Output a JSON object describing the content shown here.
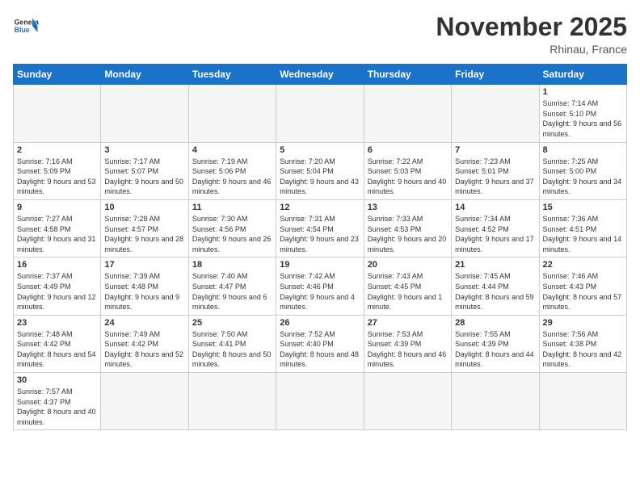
{
  "header": {
    "logo_general": "General",
    "logo_blue": "Blue",
    "month": "November 2025",
    "location": "Rhinau, France"
  },
  "days_of_week": [
    "Sunday",
    "Monday",
    "Tuesday",
    "Wednesday",
    "Thursday",
    "Friday",
    "Saturday"
  ],
  "weeks": [
    [
      {
        "day": "",
        "info": ""
      },
      {
        "day": "",
        "info": ""
      },
      {
        "day": "",
        "info": ""
      },
      {
        "day": "",
        "info": ""
      },
      {
        "day": "",
        "info": ""
      },
      {
        "day": "",
        "info": ""
      },
      {
        "day": "1",
        "info": "Sunrise: 7:14 AM\nSunset: 5:10 PM\nDaylight: 9 hours and 56 minutes."
      }
    ],
    [
      {
        "day": "2",
        "info": "Sunrise: 7:16 AM\nSunset: 5:09 PM\nDaylight: 9 hours and 53 minutes."
      },
      {
        "day": "3",
        "info": "Sunrise: 7:17 AM\nSunset: 5:07 PM\nDaylight: 9 hours and 50 minutes."
      },
      {
        "day": "4",
        "info": "Sunrise: 7:19 AM\nSunset: 5:06 PM\nDaylight: 9 hours and 46 minutes."
      },
      {
        "day": "5",
        "info": "Sunrise: 7:20 AM\nSunset: 5:04 PM\nDaylight: 9 hours and 43 minutes."
      },
      {
        "day": "6",
        "info": "Sunrise: 7:22 AM\nSunset: 5:03 PM\nDaylight: 9 hours and 40 minutes."
      },
      {
        "day": "7",
        "info": "Sunrise: 7:23 AM\nSunset: 5:01 PM\nDaylight: 9 hours and 37 minutes."
      },
      {
        "day": "8",
        "info": "Sunrise: 7:25 AM\nSunset: 5:00 PM\nDaylight: 9 hours and 34 minutes."
      }
    ],
    [
      {
        "day": "9",
        "info": "Sunrise: 7:27 AM\nSunset: 4:58 PM\nDaylight: 9 hours and 31 minutes."
      },
      {
        "day": "10",
        "info": "Sunrise: 7:28 AM\nSunset: 4:57 PM\nDaylight: 9 hours and 28 minutes."
      },
      {
        "day": "11",
        "info": "Sunrise: 7:30 AM\nSunset: 4:56 PM\nDaylight: 9 hours and 26 minutes."
      },
      {
        "day": "12",
        "info": "Sunrise: 7:31 AM\nSunset: 4:54 PM\nDaylight: 9 hours and 23 minutes."
      },
      {
        "day": "13",
        "info": "Sunrise: 7:33 AM\nSunset: 4:53 PM\nDaylight: 9 hours and 20 minutes."
      },
      {
        "day": "14",
        "info": "Sunrise: 7:34 AM\nSunset: 4:52 PM\nDaylight: 9 hours and 17 minutes."
      },
      {
        "day": "15",
        "info": "Sunrise: 7:36 AM\nSunset: 4:51 PM\nDaylight: 9 hours and 14 minutes."
      }
    ],
    [
      {
        "day": "16",
        "info": "Sunrise: 7:37 AM\nSunset: 4:49 PM\nDaylight: 9 hours and 12 minutes."
      },
      {
        "day": "17",
        "info": "Sunrise: 7:39 AM\nSunset: 4:48 PM\nDaylight: 9 hours and 9 minutes."
      },
      {
        "day": "18",
        "info": "Sunrise: 7:40 AM\nSunset: 4:47 PM\nDaylight: 9 hours and 6 minutes."
      },
      {
        "day": "19",
        "info": "Sunrise: 7:42 AM\nSunset: 4:46 PM\nDaylight: 9 hours and 4 minutes."
      },
      {
        "day": "20",
        "info": "Sunrise: 7:43 AM\nSunset: 4:45 PM\nDaylight: 9 hours and 1 minute."
      },
      {
        "day": "21",
        "info": "Sunrise: 7:45 AM\nSunset: 4:44 PM\nDaylight: 8 hours and 59 minutes."
      },
      {
        "day": "22",
        "info": "Sunrise: 7:46 AM\nSunset: 4:43 PM\nDaylight: 8 hours and 57 minutes."
      }
    ],
    [
      {
        "day": "23",
        "info": "Sunrise: 7:48 AM\nSunset: 4:42 PM\nDaylight: 8 hours and 54 minutes."
      },
      {
        "day": "24",
        "info": "Sunrise: 7:49 AM\nSunset: 4:42 PM\nDaylight: 8 hours and 52 minutes."
      },
      {
        "day": "25",
        "info": "Sunrise: 7:50 AM\nSunset: 4:41 PM\nDaylight: 8 hours and 50 minutes."
      },
      {
        "day": "26",
        "info": "Sunrise: 7:52 AM\nSunset: 4:40 PM\nDaylight: 8 hours and 48 minutes."
      },
      {
        "day": "27",
        "info": "Sunrise: 7:53 AM\nSunset: 4:39 PM\nDaylight: 8 hours and 46 minutes."
      },
      {
        "day": "28",
        "info": "Sunrise: 7:55 AM\nSunset: 4:39 PM\nDaylight: 8 hours and 44 minutes."
      },
      {
        "day": "29",
        "info": "Sunrise: 7:56 AM\nSunset: 4:38 PM\nDaylight: 8 hours and 42 minutes."
      }
    ],
    [
      {
        "day": "30",
        "info": "Sunrise: 7:57 AM\nSunset: 4:37 PM\nDaylight: 8 hours and 40 minutes."
      },
      {
        "day": "",
        "info": ""
      },
      {
        "day": "",
        "info": ""
      },
      {
        "day": "",
        "info": ""
      },
      {
        "day": "",
        "info": ""
      },
      {
        "day": "",
        "info": ""
      },
      {
        "day": "",
        "info": ""
      }
    ]
  ]
}
